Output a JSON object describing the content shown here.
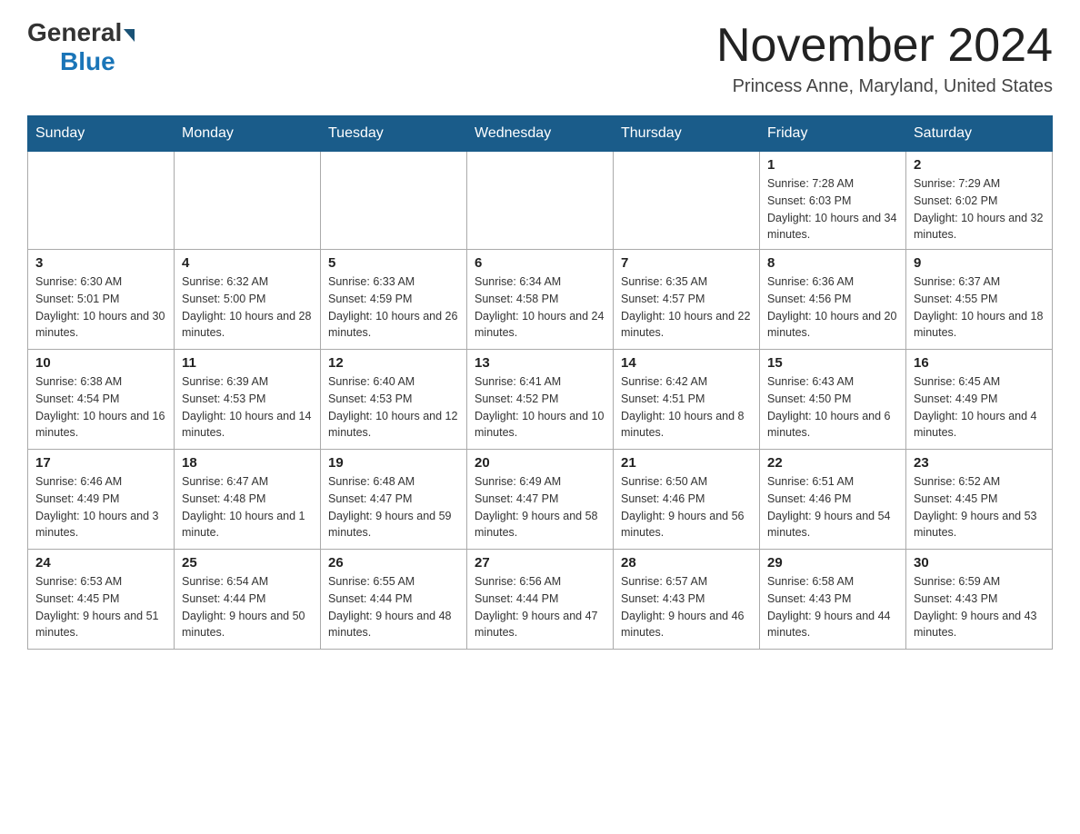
{
  "header": {
    "logo_general": "General",
    "logo_blue": "Blue",
    "month_title": "November 2024",
    "location": "Princess Anne, Maryland, United States"
  },
  "calendar": {
    "days_of_week": [
      "Sunday",
      "Monday",
      "Tuesday",
      "Wednesday",
      "Thursday",
      "Friday",
      "Saturday"
    ],
    "weeks": [
      [
        {
          "day": "",
          "sunrise": "",
          "sunset": "",
          "daylight": ""
        },
        {
          "day": "",
          "sunrise": "",
          "sunset": "",
          "daylight": ""
        },
        {
          "day": "",
          "sunrise": "",
          "sunset": "",
          "daylight": ""
        },
        {
          "day": "",
          "sunrise": "",
          "sunset": "",
          "daylight": ""
        },
        {
          "day": "",
          "sunrise": "",
          "sunset": "",
          "daylight": ""
        },
        {
          "day": "1",
          "sunrise": "Sunrise: 7:28 AM",
          "sunset": "Sunset: 6:03 PM",
          "daylight": "Daylight: 10 hours and 34 minutes."
        },
        {
          "day": "2",
          "sunrise": "Sunrise: 7:29 AM",
          "sunset": "Sunset: 6:02 PM",
          "daylight": "Daylight: 10 hours and 32 minutes."
        }
      ],
      [
        {
          "day": "3",
          "sunrise": "Sunrise: 6:30 AM",
          "sunset": "Sunset: 5:01 PM",
          "daylight": "Daylight: 10 hours and 30 minutes."
        },
        {
          "day": "4",
          "sunrise": "Sunrise: 6:32 AM",
          "sunset": "Sunset: 5:00 PM",
          "daylight": "Daylight: 10 hours and 28 minutes."
        },
        {
          "day": "5",
          "sunrise": "Sunrise: 6:33 AM",
          "sunset": "Sunset: 4:59 PM",
          "daylight": "Daylight: 10 hours and 26 minutes."
        },
        {
          "day": "6",
          "sunrise": "Sunrise: 6:34 AM",
          "sunset": "Sunset: 4:58 PM",
          "daylight": "Daylight: 10 hours and 24 minutes."
        },
        {
          "day": "7",
          "sunrise": "Sunrise: 6:35 AM",
          "sunset": "Sunset: 4:57 PM",
          "daylight": "Daylight: 10 hours and 22 minutes."
        },
        {
          "day": "8",
          "sunrise": "Sunrise: 6:36 AM",
          "sunset": "Sunset: 4:56 PM",
          "daylight": "Daylight: 10 hours and 20 minutes."
        },
        {
          "day": "9",
          "sunrise": "Sunrise: 6:37 AM",
          "sunset": "Sunset: 4:55 PM",
          "daylight": "Daylight: 10 hours and 18 minutes."
        }
      ],
      [
        {
          "day": "10",
          "sunrise": "Sunrise: 6:38 AM",
          "sunset": "Sunset: 4:54 PM",
          "daylight": "Daylight: 10 hours and 16 minutes."
        },
        {
          "day": "11",
          "sunrise": "Sunrise: 6:39 AM",
          "sunset": "Sunset: 4:53 PM",
          "daylight": "Daylight: 10 hours and 14 minutes."
        },
        {
          "day": "12",
          "sunrise": "Sunrise: 6:40 AM",
          "sunset": "Sunset: 4:53 PM",
          "daylight": "Daylight: 10 hours and 12 minutes."
        },
        {
          "day": "13",
          "sunrise": "Sunrise: 6:41 AM",
          "sunset": "Sunset: 4:52 PM",
          "daylight": "Daylight: 10 hours and 10 minutes."
        },
        {
          "day": "14",
          "sunrise": "Sunrise: 6:42 AM",
          "sunset": "Sunset: 4:51 PM",
          "daylight": "Daylight: 10 hours and 8 minutes."
        },
        {
          "day": "15",
          "sunrise": "Sunrise: 6:43 AM",
          "sunset": "Sunset: 4:50 PM",
          "daylight": "Daylight: 10 hours and 6 minutes."
        },
        {
          "day": "16",
          "sunrise": "Sunrise: 6:45 AM",
          "sunset": "Sunset: 4:49 PM",
          "daylight": "Daylight: 10 hours and 4 minutes."
        }
      ],
      [
        {
          "day": "17",
          "sunrise": "Sunrise: 6:46 AM",
          "sunset": "Sunset: 4:49 PM",
          "daylight": "Daylight: 10 hours and 3 minutes."
        },
        {
          "day": "18",
          "sunrise": "Sunrise: 6:47 AM",
          "sunset": "Sunset: 4:48 PM",
          "daylight": "Daylight: 10 hours and 1 minute."
        },
        {
          "day": "19",
          "sunrise": "Sunrise: 6:48 AM",
          "sunset": "Sunset: 4:47 PM",
          "daylight": "Daylight: 9 hours and 59 minutes."
        },
        {
          "day": "20",
          "sunrise": "Sunrise: 6:49 AM",
          "sunset": "Sunset: 4:47 PM",
          "daylight": "Daylight: 9 hours and 58 minutes."
        },
        {
          "day": "21",
          "sunrise": "Sunrise: 6:50 AM",
          "sunset": "Sunset: 4:46 PM",
          "daylight": "Daylight: 9 hours and 56 minutes."
        },
        {
          "day": "22",
          "sunrise": "Sunrise: 6:51 AM",
          "sunset": "Sunset: 4:46 PM",
          "daylight": "Daylight: 9 hours and 54 minutes."
        },
        {
          "day": "23",
          "sunrise": "Sunrise: 6:52 AM",
          "sunset": "Sunset: 4:45 PM",
          "daylight": "Daylight: 9 hours and 53 minutes."
        }
      ],
      [
        {
          "day": "24",
          "sunrise": "Sunrise: 6:53 AM",
          "sunset": "Sunset: 4:45 PM",
          "daylight": "Daylight: 9 hours and 51 minutes."
        },
        {
          "day": "25",
          "sunrise": "Sunrise: 6:54 AM",
          "sunset": "Sunset: 4:44 PM",
          "daylight": "Daylight: 9 hours and 50 minutes."
        },
        {
          "day": "26",
          "sunrise": "Sunrise: 6:55 AM",
          "sunset": "Sunset: 4:44 PM",
          "daylight": "Daylight: 9 hours and 48 minutes."
        },
        {
          "day": "27",
          "sunrise": "Sunrise: 6:56 AM",
          "sunset": "Sunset: 4:44 PM",
          "daylight": "Daylight: 9 hours and 47 minutes."
        },
        {
          "day": "28",
          "sunrise": "Sunrise: 6:57 AM",
          "sunset": "Sunset: 4:43 PM",
          "daylight": "Daylight: 9 hours and 46 minutes."
        },
        {
          "day": "29",
          "sunrise": "Sunrise: 6:58 AM",
          "sunset": "Sunset: 4:43 PM",
          "daylight": "Daylight: 9 hours and 44 minutes."
        },
        {
          "day": "30",
          "sunrise": "Sunrise: 6:59 AM",
          "sunset": "Sunset: 4:43 PM",
          "daylight": "Daylight: 9 hours and 43 minutes."
        }
      ]
    ]
  }
}
